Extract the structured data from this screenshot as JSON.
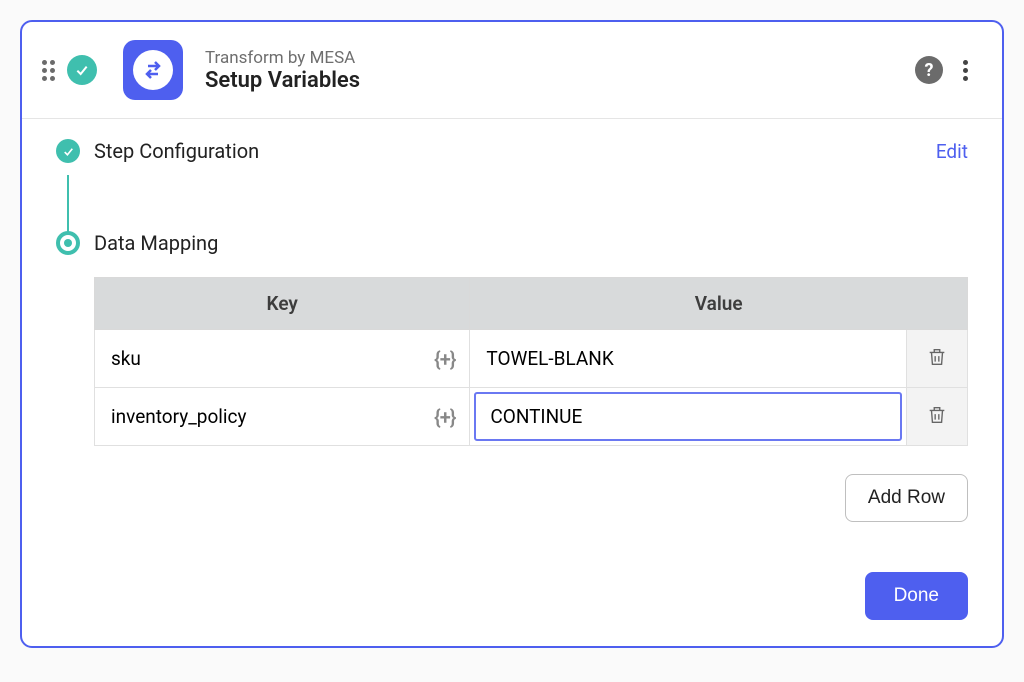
{
  "header": {
    "subtitle": "Transform by MESA",
    "title": "Setup Variables",
    "help_label": "?"
  },
  "steps": {
    "config": {
      "title": "Step Configuration",
      "edit_label": "Edit"
    },
    "mapping": {
      "title": "Data Mapping"
    }
  },
  "table": {
    "headers": {
      "key": "Key",
      "value": "Value"
    },
    "rows": [
      {
        "key": "sku",
        "value": "TOWEL-BLANK"
      },
      {
        "key": "inventory_policy",
        "value": "CONTINUE"
      }
    ],
    "insert_token": "{+}"
  },
  "actions": {
    "add_row": "Add Row",
    "done": "Done"
  }
}
